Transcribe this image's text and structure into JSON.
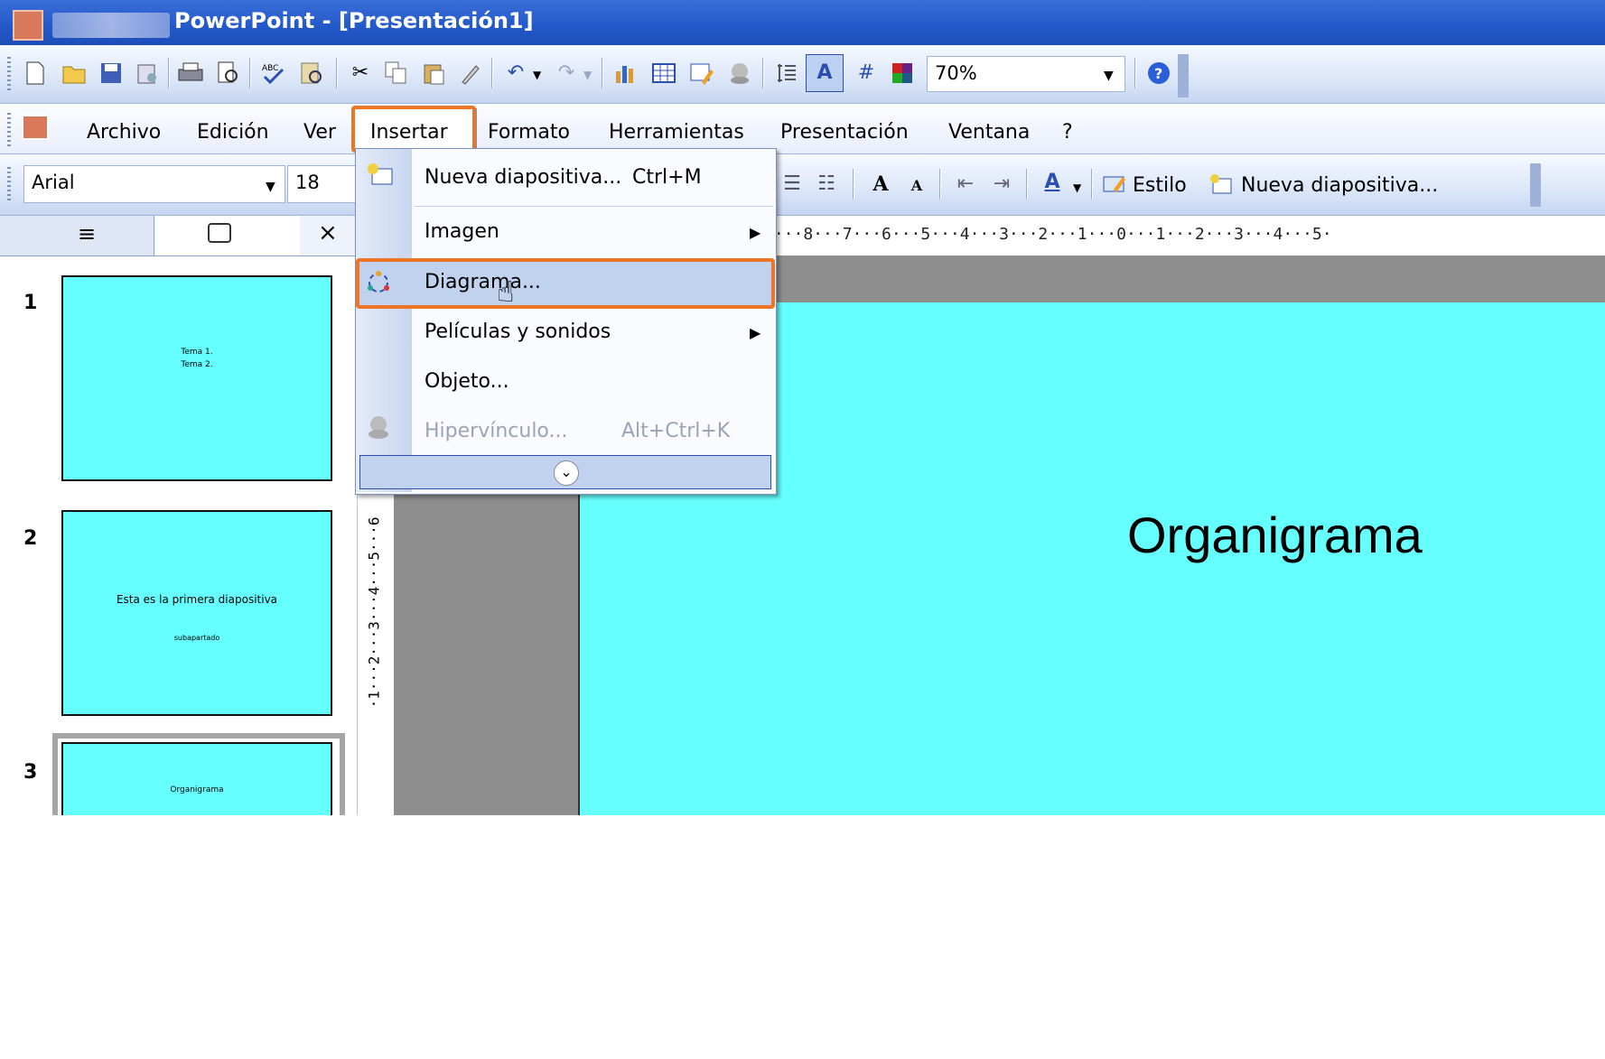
{
  "window": {
    "title": "PowerPoint - [Presentación1]"
  },
  "toolbar_standard": {
    "zoom": "70%",
    "icons": [
      "new-icon",
      "open-icon",
      "save-icon",
      "permission-icon",
      "print-icon",
      "print-preview-icon",
      "spelling-icon",
      "research-icon",
      "cut-icon",
      "copy-icon",
      "paste-icon",
      "format-painter-icon",
      "undo-icon",
      "redo-icon",
      "insert-chart-icon",
      "insert-table-icon",
      "tables-borders-icon",
      "hyperlink-icon",
      "expand-all-icon",
      "show-formatting-icon",
      "grid-icon",
      "color-grayscale-icon",
      "help-icon"
    ]
  },
  "menu": {
    "items": [
      {
        "label": "Archivo"
      },
      {
        "label": "Edición"
      },
      {
        "label": "Ver"
      },
      {
        "label": "Insertar"
      },
      {
        "label": "Formato"
      },
      {
        "label": "Herramientas"
      },
      {
        "label": "Presentación"
      },
      {
        "label": "Ventana"
      },
      {
        "label": "?"
      }
    ]
  },
  "toolbar_format": {
    "font": "Arial",
    "size": "18",
    "style_label": "Estilo",
    "new_slide_label": "Nueva diapositiva..."
  },
  "ruler_top": "9···8···7···6···5···4···3···2···1···0···1···2···3···4···5·",
  "ruler_left": "·1···2···3···4···5···6",
  "insert_menu": {
    "items": [
      {
        "label": "Nueva diapositiva...",
        "shortcut": "Ctrl+M"
      },
      {
        "label": "Imagen"
      },
      {
        "label": "Diagrama..."
      },
      {
        "label": "Películas y sonidos"
      },
      {
        "label": "Objeto..."
      },
      {
        "label": "Hipervínculo...",
        "shortcut": "Alt+Ctrl+K",
        "disabled": true
      }
    ]
  },
  "slides": [
    {
      "number": "1",
      "lines": [
        "Tema 1.",
        "Tema 2."
      ]
    },
    {
      "number": "2",
      "lines": [
        "Esta es la primera diapositiva",
        "subapartado"
      ]
    },
    {
      "number": "3",
      "lines": [
        "Organigrama"
      ]
    }
  ],
  "current_slide": {
    "title": "Organigrama"
  },
  "colors": {
    "slide_bg": "#66ffff",
    "highlight": "#ee7426",
    "titlebar": "#2358c8"
  }
}
